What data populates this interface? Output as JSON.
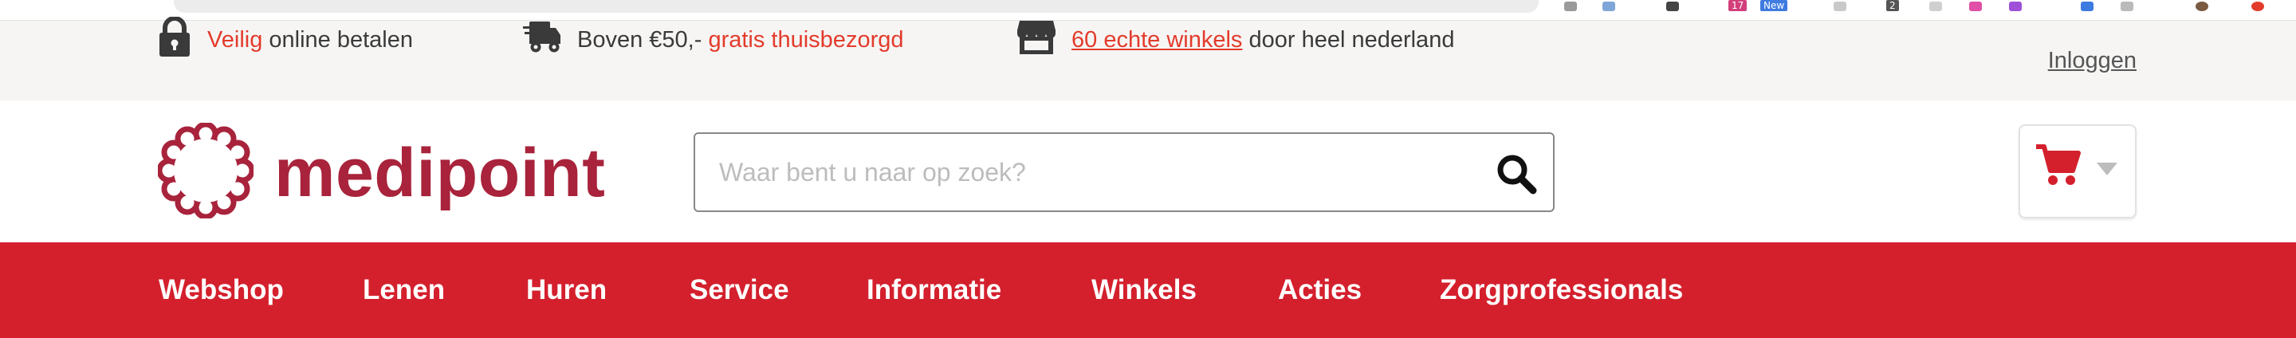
{
  "browser": {
    "badges": [
      "17",
      "New",
      "2"
    ]
  },
  "usp_bar": {
    "secure": {
      "highlight": "Veilig",
      "text": " online betalen",
      "icon": "lock-icon"
    },
    "delivery": {
      "prefix": "Boven €50,- ",
      "highlight": "gratis thuisbezorgd",
      "icon": "delivery-truck-icon"
    },
    "stores": {
      "link": "60 echte winkels",
      "text": " door heel nederland",
      "icon": "storefront-icon"
    },
    "login": "Inloggen"
  },
  "header": {
    "logo_text": "medipoint",
    "search": {
      "placeholder": "Waar bent u naar op zoek?",
      "value": "",
      "icon": "search-icon"
    },
    "cart": {
      "icon": "shopping-cart-icon",
      "caret_icon": "chevron-down-icon"
    }
  },
  "nav": {
    "items": [
      {
        "label": "Webshop"
      },
      {
        "label": "Lenen"
      },
      {
        "label": "Huren"
      },
      {
        "label": "Service"
      },
      {
        "label": "Informatie"
      },
      {
        "label": "Winkels"
      },
      {
        "label": "Acties"
      },
      {
        "label": "Zorgprofessionals"
      }
    ]
  },
  "colors": {
    "brand_red": "#d4202d",
    "logo_red": "#a8233b",
    "accent_orange": "#e33b2b",
    "usp_background": "#f6f5f4"
  }
}
